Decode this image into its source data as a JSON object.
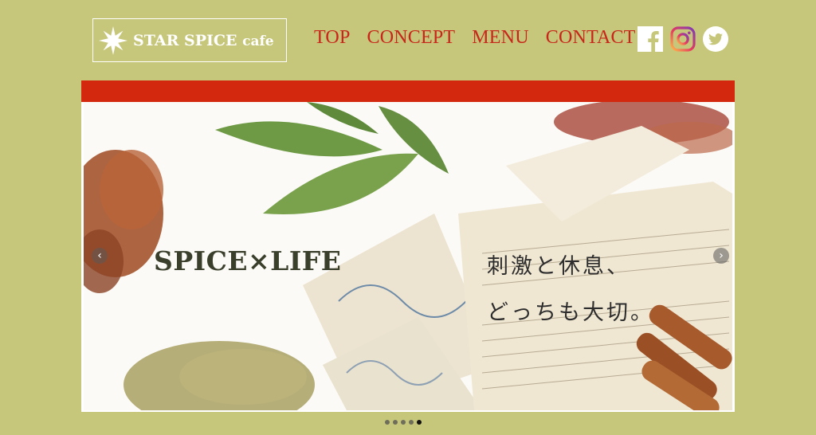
{
  "logo": {
    "name_main": "STAR SPICE",
    "name_suffix": "cafe",
    "icon": "star-icon"
  },
  "nav": {
    "items": [
      "TOP",
      "CONCEPT",
      "MENU",
      "CONTACT"
    ]
  },
  "social": {
    "icons": [
      "facebook-icon",
      "instagram-icon",
      "twitter-icon"
    ]
  },
  "hero": {
    "headline": "SPICE×LIFE",
    "tagline_line1": "刺激と休息、",
    "tagline_line2": "どっちも大切。",
    "prev_arrow": "‹",
    "next_arrow": "›"
  },
  "carousel": {
    "slide_count": 5,
    "active_index": 4
  },
  "colors": {
    "background": "#c6c77b",
    "accent_red": "#d4280e",
    "nav_text": "#c8261a"
  }
}
